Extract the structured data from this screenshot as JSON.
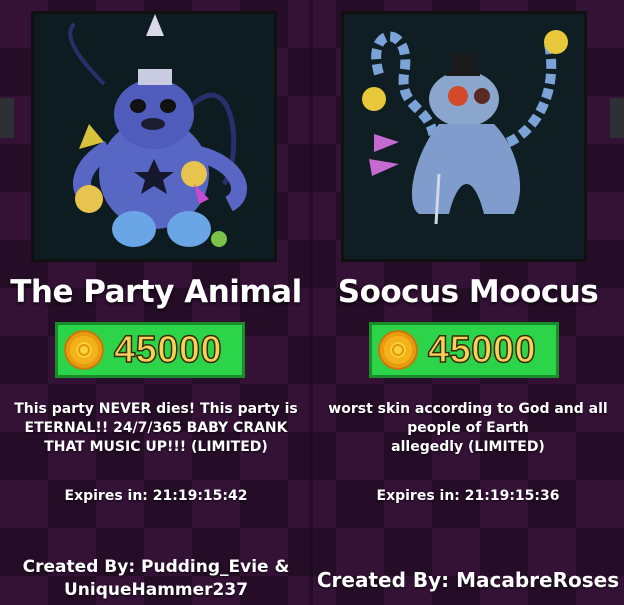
{
  "colors": {
    "background": "#331236",
    "price_bg": "#2cd44a",
    "price_text": "#f6d25a",
    "text": "#ffffff"
  },
  "currency_icon": "coin-icon",
  "items": [
    {
      "name": "The Party Animal",
      "price": "45000",
      "description": [
        "This party NEVER dies! This party is",
        "ETERNAL!! 24/7/365 BABY CRANK",
        "THAT MUSIC UP!!! (LIMITED)"
      ],
      "expires": "Expires in: 21:19:15:42",
      "creator": [
        "Created By: Pudding_Evie &",
        "UniqueHammer237"
      ]
    },
    {
      "name": "Soocus Moocus",
      "price": "45000",
      "description": [
        "worst skin according to God and all",
        "people of Earth",
        "allegedly (LIMITED)"
      ],
      "expires": "Expires in: 21:19:15:36",
      "creator": [
        "Created By: MacabreRoses"
      ]
    }
  ]
}
